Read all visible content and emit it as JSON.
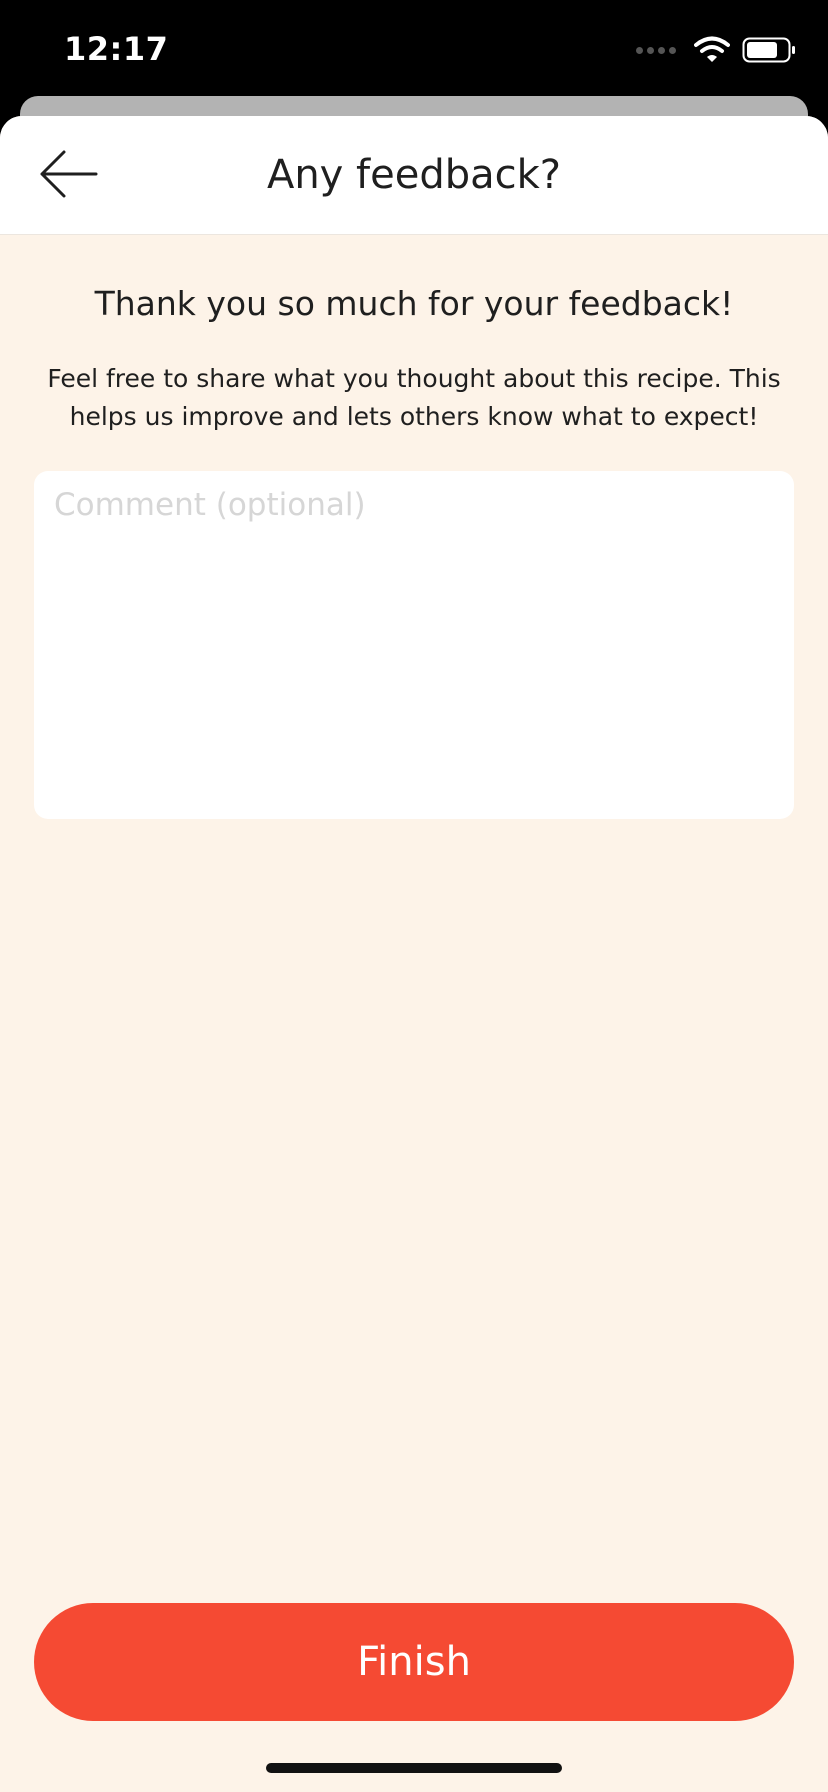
{
  "status_bar": {
    "time": "12:17"
  },
  "header": {
    "back_icon": "arrow-left-icon",
    "title": "Any feedback?"
  },
  "content": {
    "thanks_text": "Thank you so much for your feedback!",
    "description": "Feel free to share what you thought about this recipe. This helps us improve and lets others know what to expect!",
    "comment": {
      "value": "",
      "placeholder": "Comment (optional)"
    }
  },
  "footer": {
    "finish_label": "Finish"
  },
  "colors": {
    "accent": "#f54a33",
    "background": "#fdf3e8",
    "header_background": "#ffffff",
    "text": "#1f1f1f"
  }
}
